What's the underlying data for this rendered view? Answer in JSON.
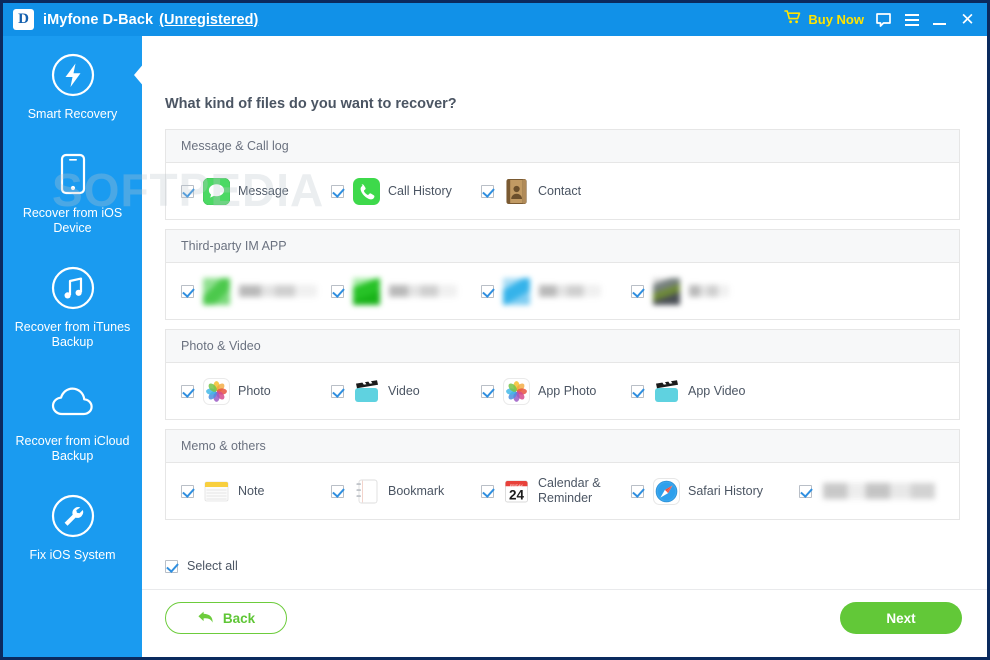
{
  "window": {
    "app_name": "iMyfone D-Back",
    "registration_status": "(Unregistered)",
    "logo_letter": "D",
    "buy_now": "Buy Now",
    "icons": {
      "cart": "cart-icon",
      "feedback": "feedback-bubble-icon",
      "menu": "hamburger-menu-icon",
      "minimize": "minimize-icon",
      "close": "close-icon"
    },
    "titlebar_color": "#1191e8",
    "border_color": "#0b2a5e"
  },
  "watermark": {
    "text": "SOFTPEDIA"
  },
  "sidebar": {
    "background": "#1a9bf0",
    "items": [
      {
        "label": "Smart\nRecovery",
        "icon": "lightning-bolt-icon",
        "active": true
      },
      {
        "label": "Recover from\niOS Device",
        "icon": "iphone-icon",
        "active": false
      },
      {
        "label": "Recover from\niTunes Backup",
        "icon": "music-note-icon",
        "active": false
      },
      {
        "label": "Recover from\niCloud Backup",
        "icon": "cloud-icon",
        "active": false
      },
      {
        "label": "Fix iOS System",
        "icon": "wrench-icon",
        "active": false
      }
    ]
  },
  "main": {
    "question": "What kind of files do you want to recover?",
    "sections": [
      {
        "title": "Message & Call log",
        "items": [
          {
            "label": "Message",
            "icon": "message-bubble-icon",
            "checked": true,
            "blurred": false
          },
          {
            "label": "Call History",
            "icon": "phone-handset-icon",
            "checked": true,
            "blurred": false
          },
          {
            "label": "Contact",
            "icon": "contacts-book-icon",
            "checked": true,
            "blurred": false
          }
        ]
      },
      {
        "title": "Third-party IM APP",
        "items": [
          {
            "label": "",
            "icon": "blurred-im-app-green-icon",
            "checked": true,
            "blurred": true,
            "blur_color": "#5cc85c"
          },
          {
            "label": "",
            "icon": "blurred-im-app-green2-icon",
            "checked": true,
            "blurred": true,
            "blur_color": "#2fc12f"
          },
          {
            "label": "",
            "icon": "blurred-im-app-blue-icon",
            "checked": true,
            "blurred": true,
            "blur_color": "#45b8ec"
          },
          {
            "label": "",
            "icon": "blurred-im-app-dark-icon",
            "checked": true,
            "blurred": true,
            "blur_color": "#5a6065"
          }
        ]
      },
      {
        "title": "Photo & Video",
        "items": [
          {
            "label": "Photo",
            "icon": "photos-pinwheel-icon",
            "checked": true,
            "blurred": false
          },
          {
            "label": "Video",
            "icon": "video-clapperboard-icon",
            "checked": true,
            "blurred": false
          },
          {
            "label": "App Photo",
            "icon": "photos-pinwheel-icon",
            "checked": true,
            "blurred": false
          },
          {
            "label": "App Video",
            "icon": "video-clapperboard-icon",
            "checked": true,
            "blurred": false
          }
        ]
      },
      {
        "title": "Memo & others",
        "items": [
          {
            "label": "Note",
            "icon": "notes-icon",
            "checked": true,
            "blurred": false
          },
          {
            "label": "Bookmark",
            "icon": "bookmark-page-icon",
            "checked": true,
            "blurred": false
          },
          {
            "label": "Calendar &\nReminder",
            "icon": "calendar-24-icon",
            "checked": true,
            "blurred": false
          },
          {
            "label": "Safari History",
            "icon": "safari-compass-icon",
            "checked": true,
            "blurred": false
          },
          {
            "label": "",
            "icon": "blurred-item-icon",
            "checked": true,
            "blurred": true,
            "blur_color": "#d8d8d8"
          }
        ]
      }
    ],
    "select_all": {
      "label": "Select all",
      "checked": true
    },
    "back_button": {
      "label": "Back",
      "icon": "back-arrow-icon",
      "color": "#5fc636"
    },
    "next_button": {
      "label": "Next",
      "color": "#62c838"
    }
  }
}
